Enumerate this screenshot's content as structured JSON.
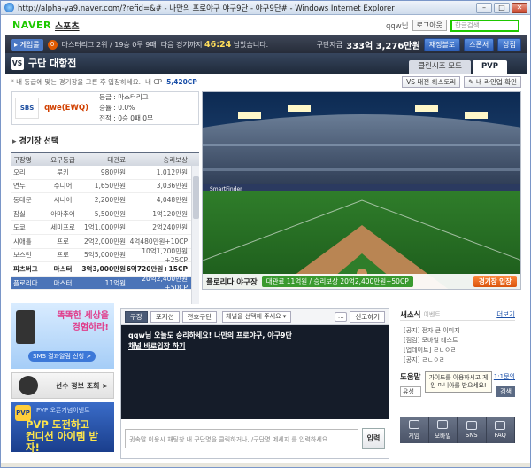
{
  "window": {
    "title": "http://alpha-ya9.naver.com/?refid=&# - 나만의 프로야구 야구9단 - 야구9단# - Windows Internet Explorer"
  },
  "naver": {
    "logo": "NAVER",
    "section": "스포츠",
    "user": "qqw님",
    "logout": "로그아웃",
    "search_placeholder": "한글검색"
  },
  "gamebar": {
    "menu": "게임룰",
    "badge": "0",
    "league": "마스터리그 2위 / 19승 0무 9패",
    "next_label": "다음 경기까지",
    "next_time": "46:24",
    "next_suffix": "남았습니다.",
    "money_label": "구단자금",
    "money": "333억 3,276만원",
    "buttons": [
      "재정블로",
      "스폰서",
      "상점"
    ]
  },
  "title": {
    "vs": "VS",
    "text": "구단 대항전",
    "tabs": [
      "클린시즈 모드",
      "PVP"
    ],
    "active_tab": "PVP"
  },
  "info": {
    "text": "* 내 등급에 맞는 경기장을 고른 후 입장하세요.",
    "cp_label": "내 CP",
    "cp": "5,420CP",
    "buttons": [
      "대전 히스토리",
      "내 라인업 확인"
    ]
  },
  "team": {
    "logo": "SBS",
    "name": "qwe(EWQ)",
    "grade": "등급 : 마스터리그",
    "winrate": "승률 : 0.0%",
    "record": "전적 : 0승 0패 0무"
  },
  "stadium_select": {
    "title": "경기장 선택",
    "headers": [
      "구장명",
      "요구등급",
      "대관료",
      "승리보상"
    ],
    "rows": [
      {
        "name": "오리",
        "grade": "루키",
        "fee": "980만원",
        "reward": "1,012만원",
        "bold": false,
        "selected": false
      },
      {
        "name": "연두",
        "grade": "주니어",
        "fee": "1,650만원",
        "reward": "3,036만원",
        "bold": false,
        "selected": false
      },
      {
        "name": "동대문",
        "grade": "시니어",
        "fee": "2,200만원",
        "reward": "4,048만원",
        "bold": false,
        "selected": false
      },
      {
        "name": "잠실",
        "grade": "아마추어",
        "fee": "5,500만원",
        "reward": "1억120만원",
        "bold": false,
        "selected": false
      },
      {
        "name": "도쿄",
        "grade": "세미프로",
        "fee": "1억1,000만원",
        "reward": "2억240만원",
        "bold": false,
        "selected": false
      },
      {
        "name": "시애틀",
        "grade": "프로",
        "fee": "2억2,000만원",
        "reward": "4억480만원+10CP",
        "bold": false,
        "selected": false
      },
      {
        "name": "보스턴",
        "grade": "프로",
        "fee": "5억5,000만원",
        "reward": "10억1,200만원+25CP",
        "bold": false,
        "selected": false
      },
      {
        "name": "피츠버그",
        "grade": "마스터",
        "fee": "3억3,000만원",
        "reward": "6억720만원+15CP",
        "bold": true,
        "selected": false
      },
      {
        "name": "플로리다",
        "grade": "마스터",
        "fee": "11억원",
        "reward": "20억2,400만원+50CP",
        "bold": false,
        "selected": true
      }
    ]
  },
  "stadium": {
    "name": "플로리다 야구장",
    "info": "대관료 11억원 / 승리보상 20억2,400만원+50CP",
    "enter": "경기장 입장",
    "sign": "SmartFinder"
  },
  "ads": {
    "ad1": {
      "text": [
        "똑똑한 세상을",
        "경험하라!"
      ],
      "button": "SMS 결과알림 신청 >"
    },
    "ad2": {
      "text": "선수 정보 조회 >"
    },
    "ad3": {
      "small": "PVP 오픈기념이벤트",
      "big": [
        "PVP 도전하고",
        "컨디션 아이템 받자!"
      ],
      "icon": "PVP"
    }
  },
  "chat": {
    "tabs": [
      "구장",
      "포지션",
      "전호구단"
    ],
    "active_tab": "구장",
    "select": "채널을 선택해 주세요",
    "report": "신고하기",
    "messages": [
      "qqw님 오늘도 승리하세요! 나만의 프로야구, 야구9단"
    ],
    "link": "채널 바로입장 하기",
    "input_placeholder": "귓속말 이용시 채팅창 내 구단명을 클릭하거나, /구단명 메세지 를 입력하세요.",
    "send": "입력"
  },
  "news": {
    "title": "새소식",
    "sub": "이벤트",
    "more": "더보기",
    "items": [
      "[공지] 전자 큰 이미지",
      "[점검] 모바일 테스트",
      "[업데이트] ㄹㄴㅇㄹ",
      "[공지] ㄹㄴㅇㄹ"
    ]
  },
  "help": {
    "title": "도움말",
    "more": "1:1문의",
    "field": "유성",
    "search": "검색",
    "tooltip": "가이드를 이용하시고 게임 마니아를 받으세요!"
  },
  "iconbar": {
    "items": [
      "게임",
      "모바일",
      "SNS",
      "FAQ"
    ]
  }
}
